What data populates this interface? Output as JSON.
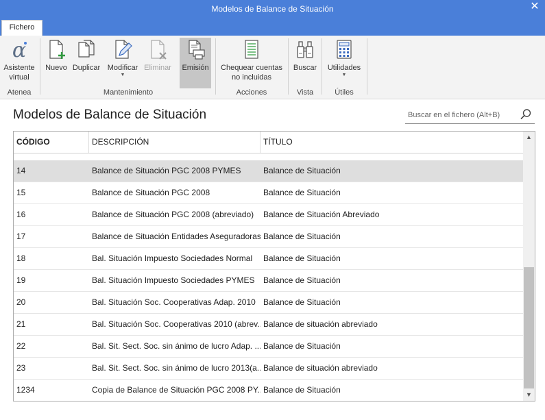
{
  "window": {
    "title": "Modelos de Balance de Situación",
    "close_glyph": "✕"
  },
  "ribbon": {
    "tab": "Fichero",
    "groups": {
      "atenea": "Atenea",
      "mantenimiento": "Mantenimiento",
      "acciones": "Acciones",
      "vista": "Vista",
      "utiles": "Útiles"
    },
    "buttons": {
      "asistente_line1": "Asistente",
      "asistente_line2": "virtual",
      "nuevo": "Nuevo",
      "duplicar": "Duplicar",
      "modificar": "Modificar",
      "eliminar": "Eliminar",
      "emision": "Emisión",
      "chequear_line1": "Chequear cuentas",
      "chequear_line2": "no incluidas",
      "buscar": "Buscar",
      "utilidades": "Utilidades"
    },
    "accent": "#4a7fd9"
  },
  "page": {
    "title": "Modelos de Balance de Situación",
    "search_placeholder": "Buscar en el fichero (Alt+B)"
  },
  "grid": {
    "columns": [
      "CÓDIGO",
      "DESCRIPCIÓN",
      "TÍTULO"
    ],
    "rows": [
      [
        "14",
        "Balance de Situación PGC 2008 PYMES",
        "Balance de Situación"
      ],
      [
        "15",
        "Balance de Situación PGC 2008",
        "Balance de Situación"
      ],
      [
        "16",
        "Balance de Situación PGC 2008 (abreviado)",
        "Balance de Situación Abreviado"
      ],
      [
        "17",
        "Balance de Situación Entidades Aseguradoras",
        "Balance de Situación"
      ],
      [
        "18",
        "Bal. Situación  Impuesto Sociedades Normal",
        "Balance de Situación"
      ],
      [
        "19",
        "Bal. Situación  Impuesto Sociedades PYMES",
        "Balance de Situación"
      ],
      [
        "20",
        "Bal. Situación Soc. Cooperativas Adap. 2010",
        "Balance de Situación"
      ],
      [
        "21",
        "Bal. Situación Soc. Cooperativas 2010 (abrev...",
        "Balance de situación abreviado"
      ],
      [
        "22",
        "Bal. Sit. Sect. Soc. sin ánimo de lucro Adap. ...",
        "Balance de Situación"
      ],
      [
        "23",
        "Bal. Sit. Sect. Soc. sin ánimo de lucro 2013(a...",
        "Balance de situación abreviado"
      ],
      [
        "1234",
        "Copia de Balance de Situación PGC 2008 PY...",
        "Balance de Situación"
      ]
    ],
    "selected_row": 0
  }
}
